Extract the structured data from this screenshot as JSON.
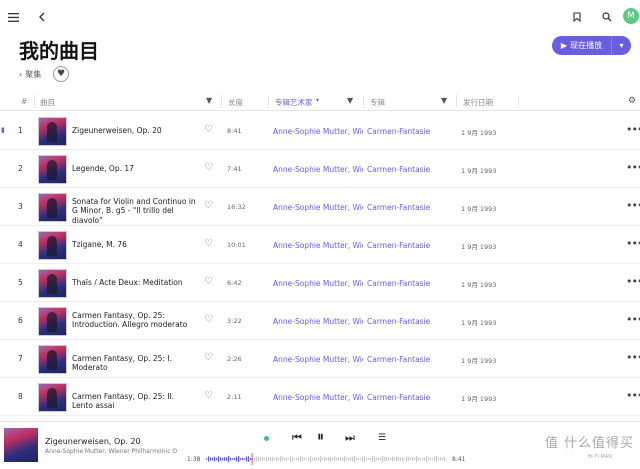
{
  "page": {
    "title": "我的曲目",
    "collection_label": "聚集",
    "play_button_label": "现在播放"
  },
  "table": {
    "headers": {
      "num": "#",
      "title": "曲目",
      "duration": "长度",
      "artist": "专辑艺术家",
      "album": "专辑",
      "date": "发行日期"
    },
    "rows": [
      {
        "num": "1",
        "title": "Zigeunerweisen, Op. 20",
        "duration": "8:41",
        "artist": "Anne-Sophie Mutter, Wiener",
        "album": "Carmen-Fantasie",
        "date": "1 9月 1993"
      },
      {
        "num": "2",
        "title": "Legende, Op. 17",
        "duration": "7:41",
        "artist": "Anne-Sophie Mutter, Wiener",
        "album": "Carmen-Fantasie",
        "date": "1 9月 1993"
      },
      {
        "num": "3",
        "title": "Sonata for Violin and Continuo in G Minor, B. g5 - \"Il trillo del diavolo\"",
        "duration": "16:32",
        "artist": "Anne-Sophie Mutter, Wiener",
        "album": "Carmen-Fantasie",
        "date": "1 9月 1993"
      },
      {
        "num": "4",
        "title": "Tzigane, M. 76",
        "duration": "10:01",
        "artist": "Anne-Sophie Mutter, Wiener",
        "album": "Carmen-Fantasie",
        "date": "1 9月 1993"
      },
      {
        "num": "5",
        "title": "Thaïs / Acte Deux: Meditation",
        "duration": "6:42",
        "artist": "Anne-Sophie Mutter, Wiener",
        "album": "Carmen-Fantasie",
        "date": "1 9月 1993"
      },
      {
        "num": "6",
        "title": "Carmen Fantasy, Op. 25: Introduction. Allegro moderato",
        "duration": "3:22",
        "artist": "Anne-Sophie Mutter, Wiener",
        "album": "Carmen-Fantasie",
        "date": "1 9月 1993"
      },
      {
        "num": "7",
        "title": "Carmen Fantasy, Op. 25: I. Moderato",
        "duration": "2:26",
        "artist": "Anne-Sophie Mutter, Wiener",
        "album": "Carmen-Fantasie",
        "date": "1 9月 1993"
      },
      {
        "num": "8",
        "title": "Carmen Fantasy, Op. 25: II. Lento assai",
        "duration": "2:11",
        "artist": "Anne-Sophie Mutter, Wiener",
        "album": "Carmen-Fantasie",
        "date": "1 9月 1993"
      }
    ]
  },
  "player": {
    "title": "Zigeunerweisen, Op. 20",
    "artist": "Anne-Sophie Mutter, Wiener Philharmonic Orchestra",
    "elapsed": "1:38",
    "total": "8:41",
    "progress": 0.19
  },
  "avatar_letter": "M",
  "watermark": "值 什么值得买",
  "watermark_sub": "HI-FI MAN",
  "colors": {
    "accent": "#6a5ee0",
    "status_dot": "#3cc07a"
  }
}
